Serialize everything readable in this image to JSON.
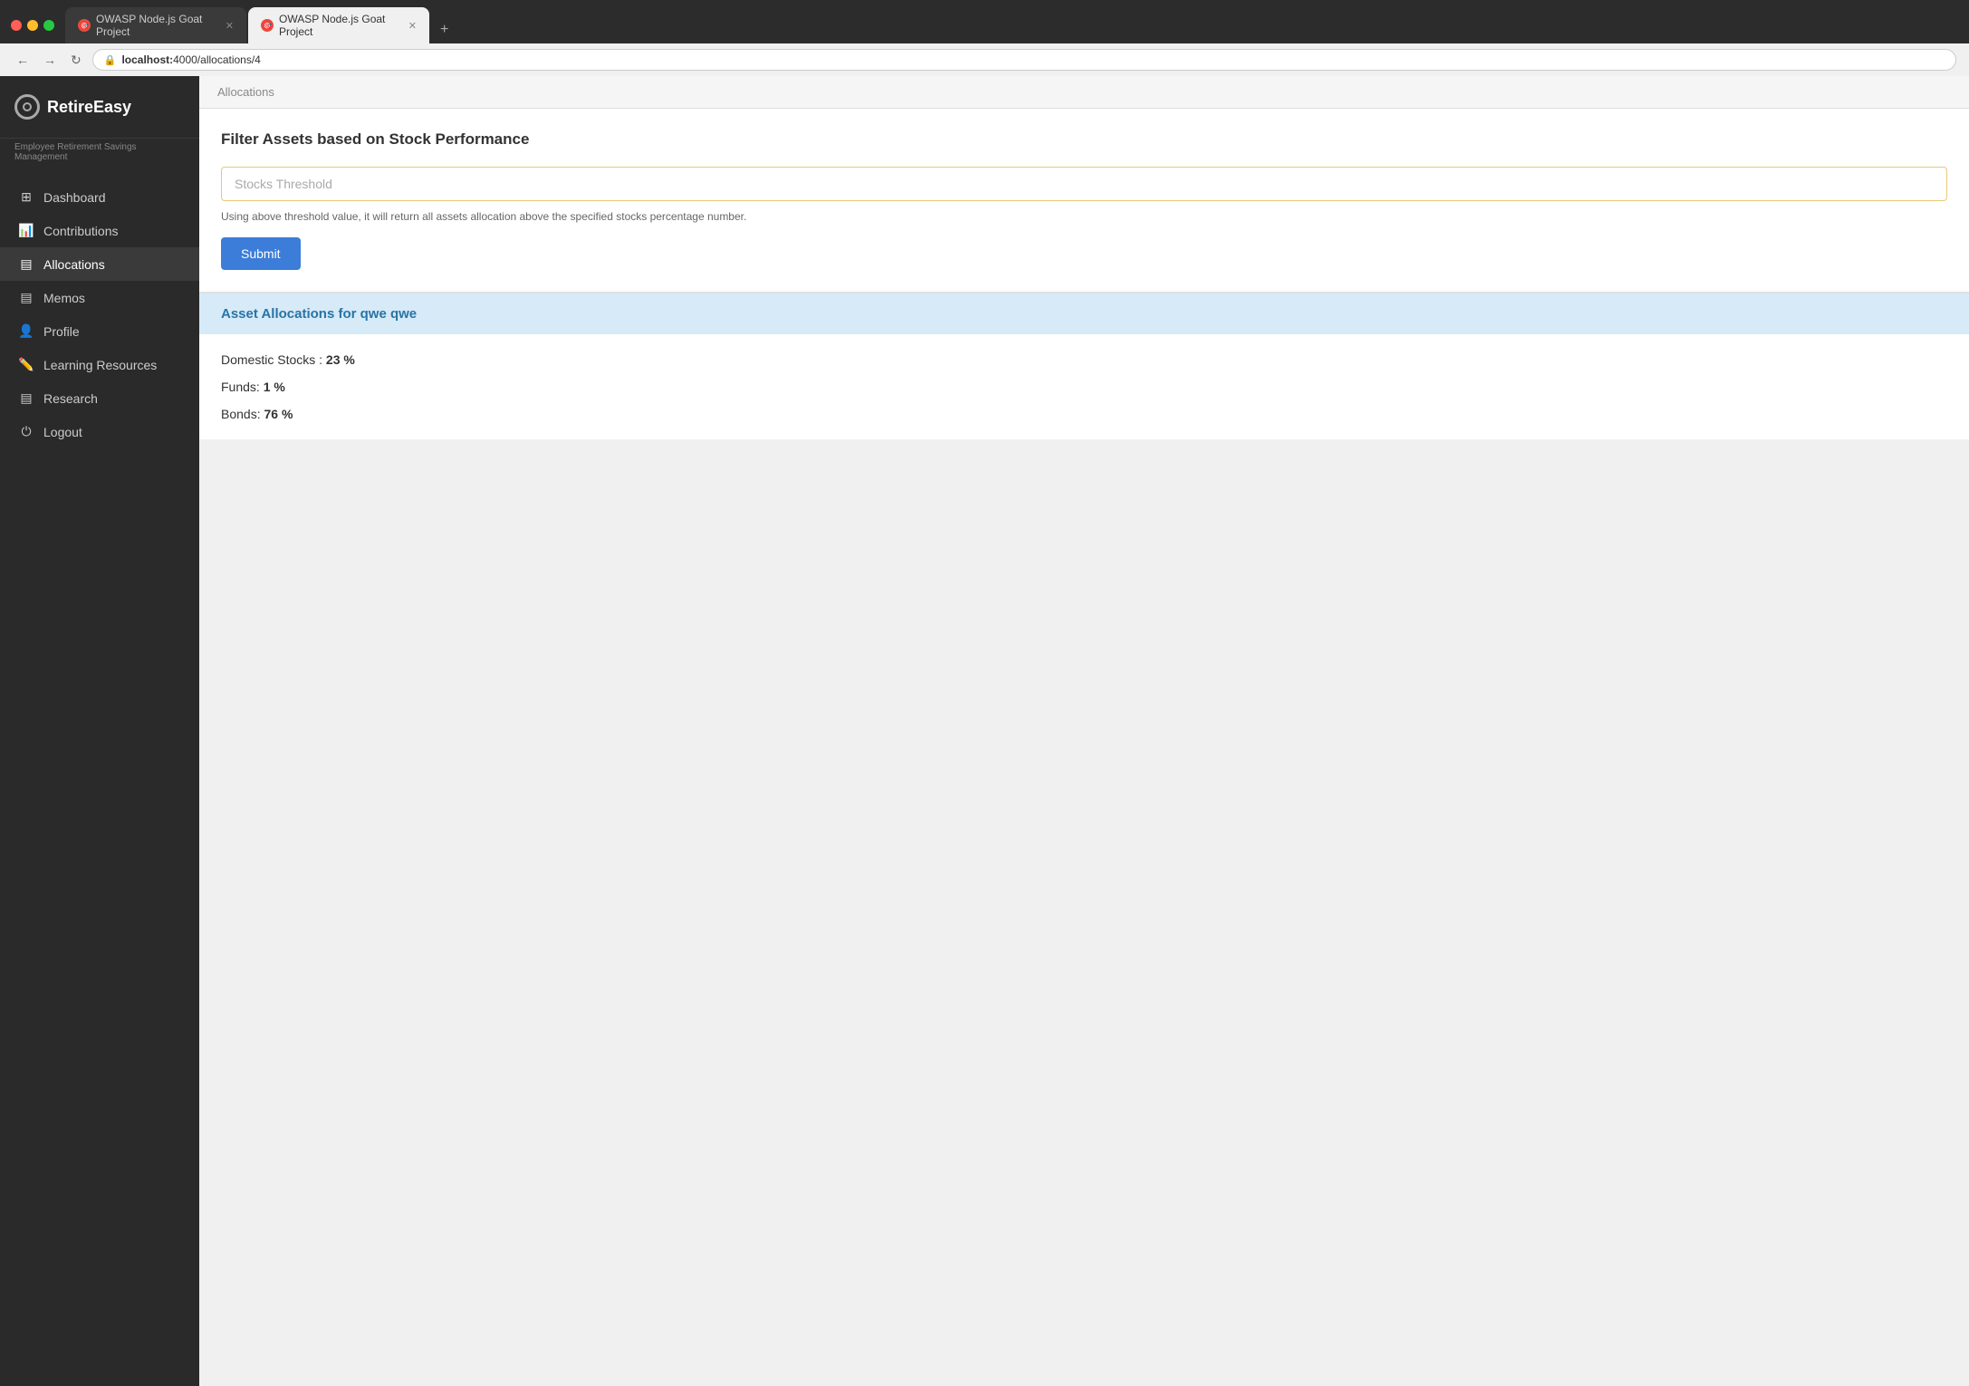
{
  "browser": {
    "tabs": [
      {
        "id": "tab1",
        "icon": "🎯",
        "label": "OWASP Node.js Goat Project",
        "active": false,
        "closeable": true
      },
      {
        "id": "tab2",
        "icon": "🎯",
        "label": "OWASP Node.js Goat Project",
        "active": true,
        "closeable": true
      }
    ],
    "new_tab_label": "+",
    "back_btn": "←",
    "forward_btn": "→",
    "reload_btn": "↻",
    "address": {
      "protocol": "localhost:",
      "path": "4000/allocations/4"
    }
  },
  "brand": {
    "name_part1": "Retire",
    "name_part2": "Easy",
    "subtitle": "Employee Retirement Savings Management"
  },
  "sidebar": {
    "items": [
      {
        "id": "dashboard",
        "icon": "▦",
        "label": "Dashboard"
      },
      {
        "id": "contributions",
        "icon": "📊",
        "label": "Contributions"
      },
      {
        "id": "allocations",
        "icon": "▤",
        "label": "Allocations",
        "active": true
      },
      {
        "id": "memos",
        "icon": "▤",
        "label": "Memos"
      },
      {
        "id": "profile",
        "icon": "👤",
        "label": "Profile"
      },
      {
        "id": "learning",
        "icon": "✏️",
        "label": "Learning Resources"
      },
      {
        "id": "research",
        "icon": "▤",
        "label": "Research"
      },
      {
        "id": "logout",
        "icon": "⏻",
        "label": "Logout"
      }
    ]
  },
  "breadcrumb": "Allocations",
  "filter": {
    "title": "Filter Assets based on Stock Performance",
    "input_placeholder": "Stocks Threshold",
    "hint": "Using above threshold value, it will return all assets allocation above the specified stocks percentage number.",
    "submit_label": "Submit"
  },
  "results": {
    "title": "Asset Allocations for qwe qwe",
    "items": [
      {
        "label": "Domestic Stocks :",
        "value": "23 %"
      },
      {
        "label": "Funds:",
        "value": "1 %"
      },
      {
        "label": "Bonds:",
        "value": "76 %"
      }
    ]
  }
}
